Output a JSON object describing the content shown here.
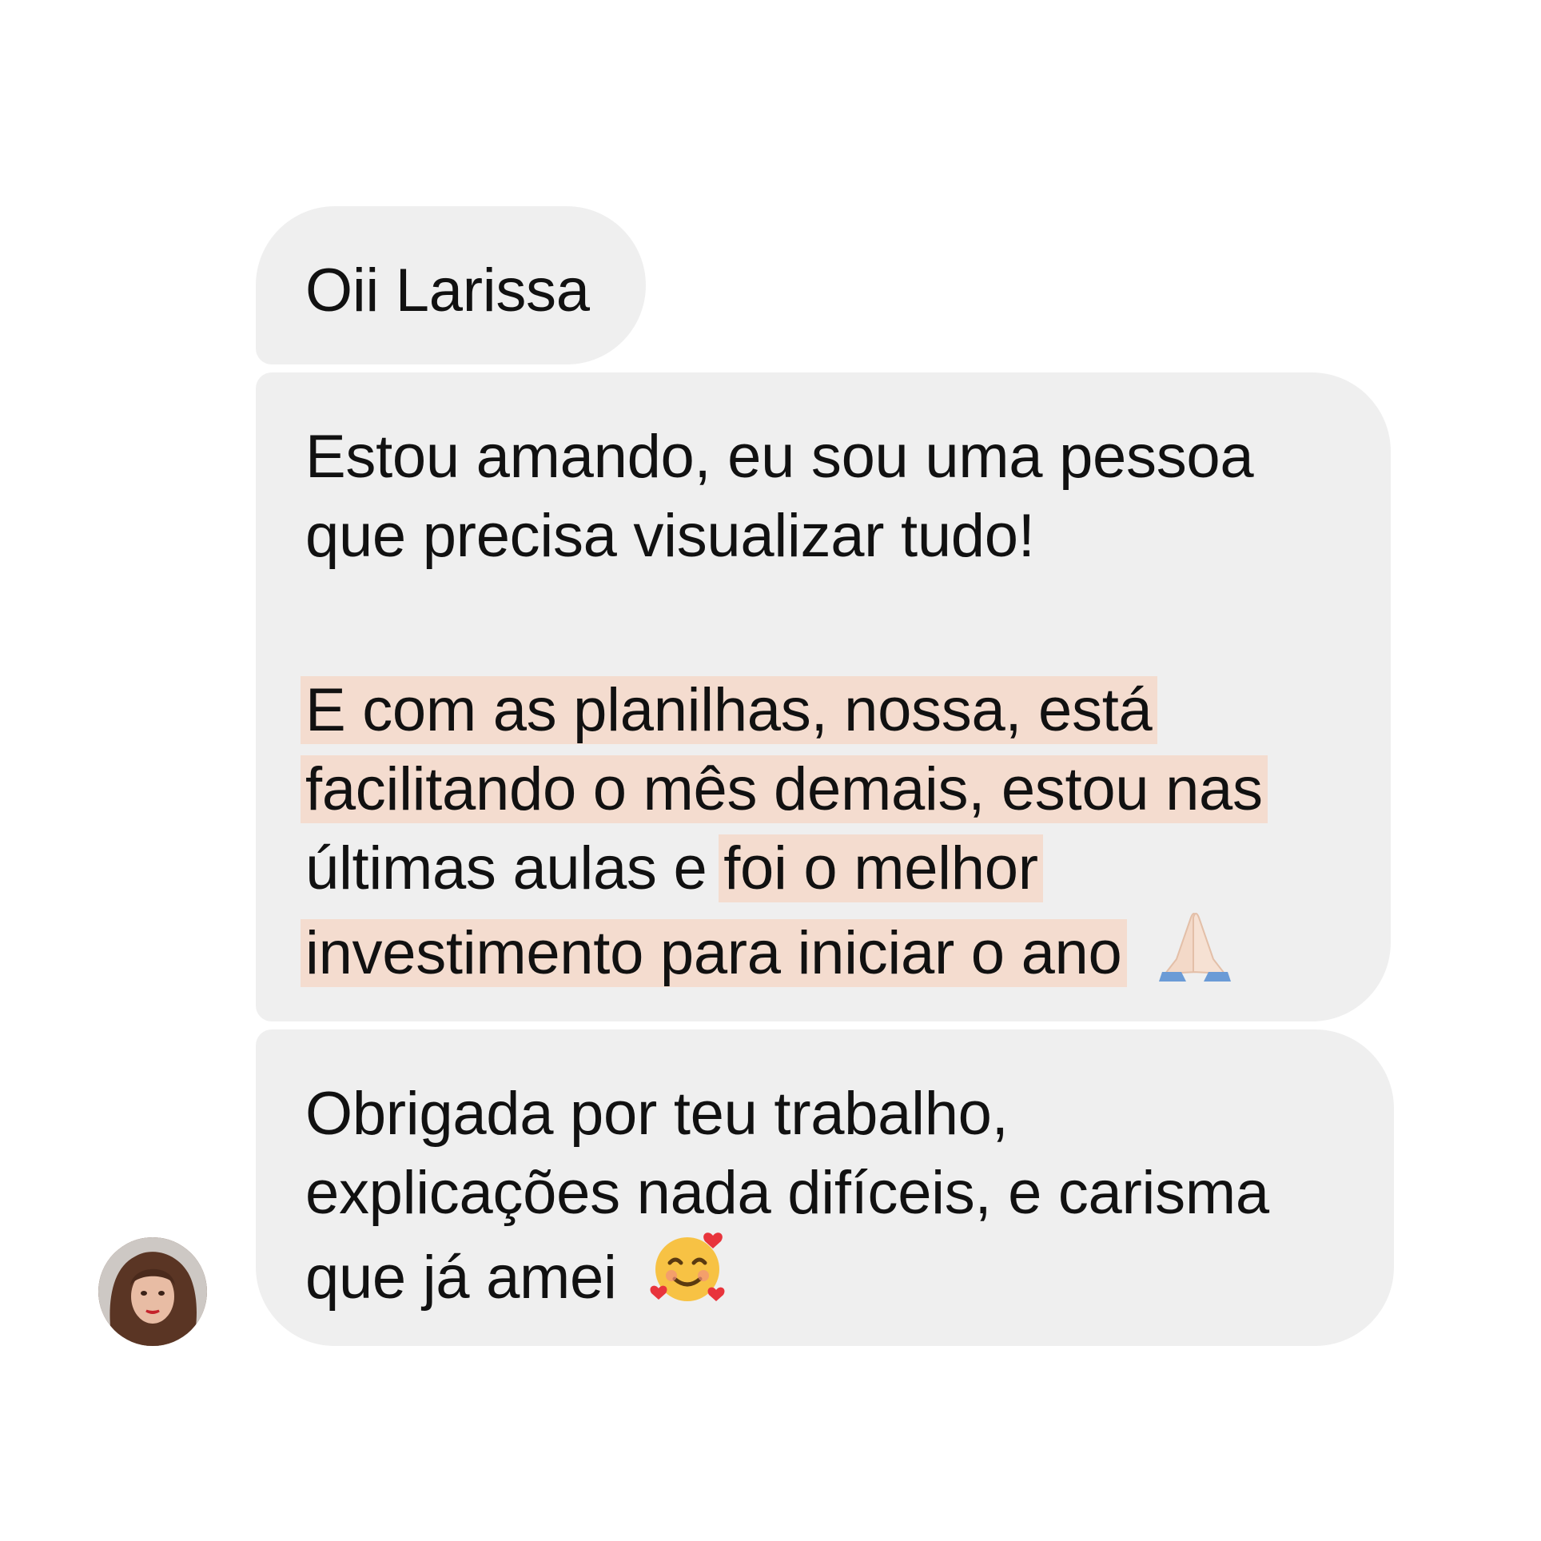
{
  "conversation": {
    "messages": [
      {
        "lines": [
          {
            "segments": [
              {
                "text": "Oii Larissa"
              }
            ]
          }
        ]
      },
      {
        "lines": [
          {
            "segments": [
              {
                "text": "Estou amando, eu sou uma pessoa"
              }
            ]
          },
          {
            "segments": [
              {
                "text": "que precisa visualizar tudo!"
              }
            ]
          },
          {
            "segments": [
              {
                "text": "E com as planilhas, nossa, está",
                "highlight": true
              }
            ]
          },
          {
            "segments": [
              {
                "text": "facilitando o mês demais, estou nas",
                "highlight": true
              }
            ]
          },
          {
            "segments": [
              {
                "text": "últimas aulas e "
              },
              {
                "text": "foi o melhor",
                "highlight": true
              }
            ]
          },
          {
            "segments": [
              {
                "text": "investimento para iniciar o ano",
                "highlight": true
              }
            ],
            "emoji": "folded-hands-icon"
          }
        ]
      },
      {
        "lines": [
          {
            "segments": [
              {
                "text": "Obrigada por teu trabalho,"
              }
            ]
          },
          {
            "segments": [
              {
                "text": "explicações nada difíceis, e carisma"
              }
            ]
          },
          {
            "segments": [
              {
                "text": "que já amei"
              }
            ],
            "emoji": "smiling-face-with-hearts-icon"
          }
        ]
      }
    ]
  },
  "colors": {
    "bubble": "#efefef",
    "highlight": "#f4dccf",
    "text": "#111111"
  }
}
